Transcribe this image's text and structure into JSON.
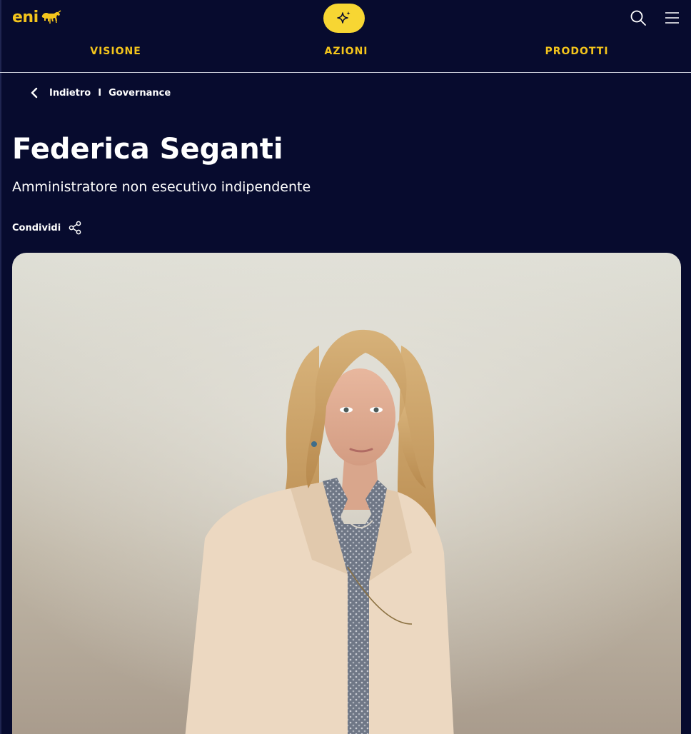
{
  "header": {
    "logo_text": "eni",
    "ai_button_icon": "sparkle-icon",
    "search_icon": "search-icon",
    "menu_icon": "hamburger-menu-icon",
    "brand_color": "#f4c51c",
    "accent_color": "#f7d633",
    "background_color": "#070b2e"
  },
  "nav": {
    "items": [
      {
        "label": "VISIONE"
      },
      {
        "label": "AZIONI"
      },
      {
        "label": "PRODOTTI"
      }
    ]
  },
  "breadcrumb": {
    "back_label": "Indietro",
    "separator": "I",
    "section_label": "Governance"
  },
  "profile": {
    "name": "Federica Seganti",
    "role": "Amministratore non esecutivo indipendente",
    "share_label": "Condividi"
  },
  "photo": {
    "subject": "portrait-photo"
  }
}
